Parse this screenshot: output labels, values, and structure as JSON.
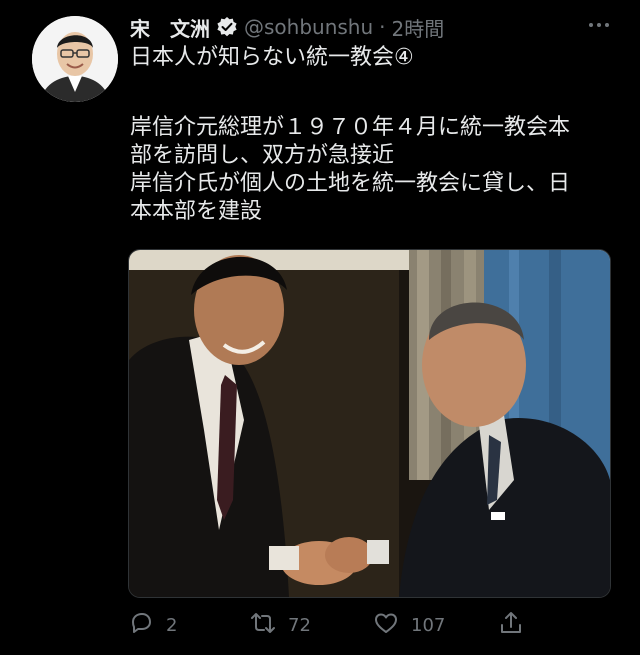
{
  "tweet": {
    "author_name": "宋　文洲",
    "handle": "@sohbunshu",
    "separator": "·",
    "time": "2時間",
    "more_icon": "ellipsis-icon",
    "lines": [
      "日本人が知らない統一教会④",
      "岸信介元総理が１９７０年４月に統一教会本\n部を訪問し、双方が急接近\n岸信介氏が個人の土地を統一教会に貸し、日\n本本部を建設"
    ]
  },
  "actions": {
    "reply_count": "2",
    "retweet_count": "72",
    "like_count": "107",
    "reply_icon": "reply-icon",
    "retweet_icon": "retweet-icon",
    "like_icon": "heart-icon",
    "share_icon": "share-icon"
  }
}
